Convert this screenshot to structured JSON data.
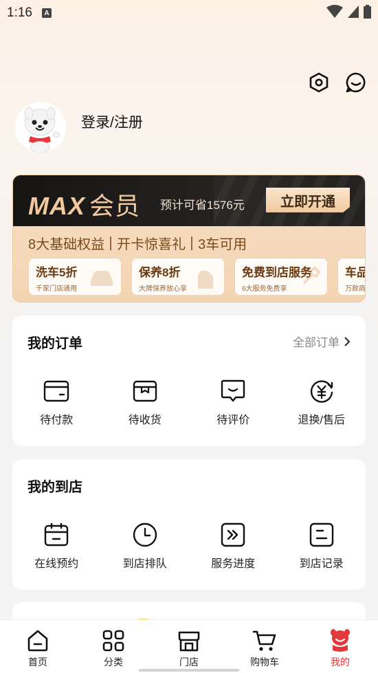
{
  "status_bar": {
    "time": "1:16",
    "a_icon": "A"
  },
  "header": {
    "settings_icon": "settings-icon",
    "message_icon": "message-icon"
  },
  "profile": {
    "login_label": "登录/注册"
  },
  "max_card": {
    "logo_text": "MAX",
    "logo_cn": "会员",
    "save_text": "预计可省1576元",
    "open_button": "立即开通",
    "benefits": [
      "8大基础权益",
      "开卡惊喜礼",
      "3车可用"
    ],
    "perks": [
      {
        "title": "洗车5折",
        "sub": "千家门店通用"
      },
      {
        "title": "保养8折",
        "sub": "大牌保养放心享"
      },
      {
        "title": "免费到店服务",
        "sub": "6大服务免费享"
      },
      {
        "title": "车品",
        "sub": "万款商"
      }
    ]
  },
  "orders": {
    "title": "我的订单",
    "more": "全部订单",
    "items": [
      {
        "label": "待付款",
        "icon": "wallet-icon"
      },
      {
        "label": "待收货",
        "icon": "package-icon"
      },
      {
        "label": "待评价",
        "icon": "comment-icon"
      },
      {
        "label": "退换/售后",
        "icon": "refund-icon"
      }
    ]
  },
  "store_visits": {
    "title": "我的到店",
    "items": [
      {
        "label": "在线预约",
        "icon": "calendar-icon"
      },
      {
        "label": "到店排队",
        "icon": "clock-icon"
      },
      {
        "label": "服务进度",
        "icon": "progress-icon"
      },
      {
        "label": "到店记录",
        "icon": "record-icon"
      }
    ]
  },
  "tabbar": {
    "active": "我的",
    "items": [
      {
        "label": "首页",
        "icon": "home-icon"
      },
      {
        "label": "分类",
        "icon": "category-icon"
      },
      {
        "label": "门店",
        "icon": "store-icon"
      },
      {
        "label": "购物车",
        "icon": "cart-icon"
      },
      {
        "label": "我的",
        "icon": "mine-icon"
      }
    ]
  },
  "colors": {
    "accent": "#e4393c",
    "gold": "#f2c99e",
    "brown": "#7a4a1c"
  }
}
